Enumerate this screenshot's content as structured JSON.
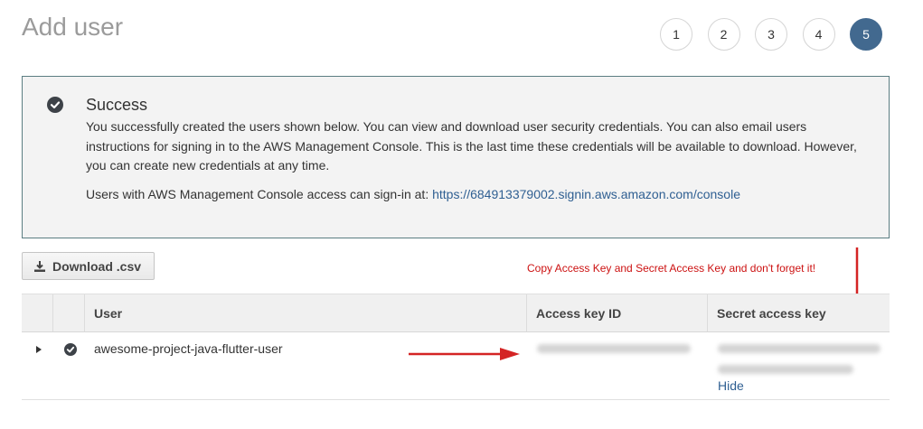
{
  "page": {
    "title": "Add user"
  },
  "steps": [
    "1",
    "2",
    "3",
    "4",
    "5"
  ],
  "active_step": "5",
  "success": {
    "title": "Success",
    "body": "You successfully created the users shown below. You can view and download user security credentials. You can also email users instructions for signing in to the AWS Management Console. This is the last time these credentials will be available to download. However, you can create new credentials at any time.",
    "signin_prefix": "Users with AWS Management Console access can sign-in at:",
    "signin_url": "https://684913379002.signin.aws.amazon.com/console",
    "icon": "check-circle-icon"
  },
  "toolbar": {
    "download_label": "Download .csv",
    "download_icon": "download-icon"
  },
  "annotation": {
    "text": "Copy Access Key and Secret Access Key and don't forget it!",
    "color": "#cc1111"
  },
  "table": {
    "columns": [
      "",
      "",
      "User",
      "Access key ID",
      "Secret access key"
    ],
    "rows": [
      {
        "user": "awesome-project-java-flutter-user",
        "secret_action": "Hide"
      }
    ]
  },
  "colors": {
    "accent": "#42698f",
    "link": "#2f5f92",
    "success_border": "#5b7d82",
    "arrow": "#d42424"
  }
}
